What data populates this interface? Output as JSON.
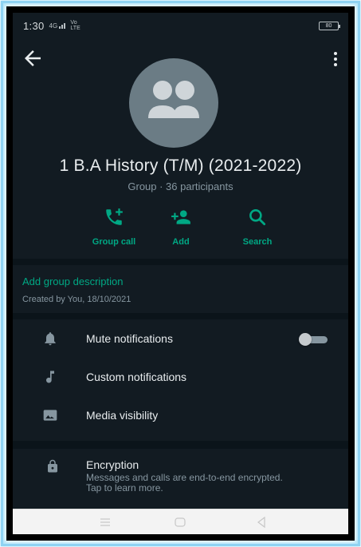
{
  "status_bar": {
    "time": "1:30",
    "signal": "4G",
    "network": "Vo LTE",
    "battery": "80"
  },
  "group": {
    "name": "1 B.A History (T/M) (2021-2022)",
    "subtitle": "Group · 36 participants"
  },
  "actions": [
    {
      "label": "Group call",
      "icon": "group-call-icon"
    },
    {
      "label": "Add",
      "icon": "add-person-icon"
    },
    {
      "label": "Search",
      "icon": "search-icon"
    }
  ],
  "description": {
    "add_label": "Add group description",
    "created": "Created by You, 18/10/2021"
  },
  "settings": [
    {
      "label": "Mute notifications",
      "icon": "bell-icon",
      "toggle": false
    },
    {
      "label": "Custom notifications",
      "icon": "music-note-icon"
    },
    {
      "label": "Media visibility",
      "icon": "image-icon"
    }
  ],
  "encryption": {
    "title": "Encryption",
    "description": "Messages and calls are end-to-end encrypted. Tap to learn more.",
    "icon": "lock-icon"
  },
  "colors": {
    "background": "#121b22",
    "accent": "#00a884",
    "text_primary": "#e9edef",
    "text_secondary": "#8696a0"
  }
}
